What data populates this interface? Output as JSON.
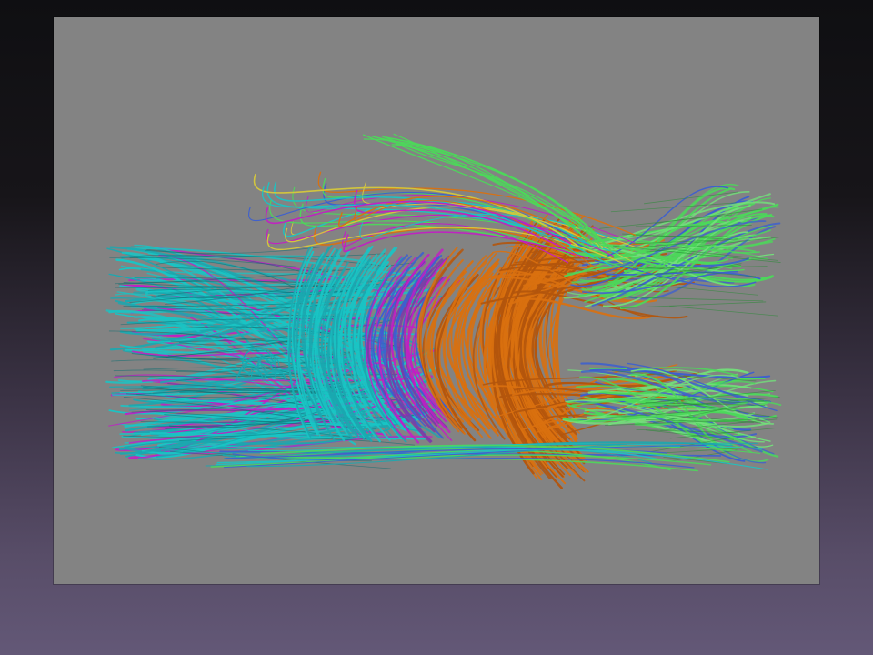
{
  "slide": {
    "background_top": "#0f0f12",
    "background_bottom": "#635877"
  },
  "figure": {
    "kind": "tractography-fiber-rendering",
    "panel_color": "#838383",
    "caption": "",
    "fiber_colors": {
      "cyan": "#19c4c4",
      "teal": "#1aa8b0",
      "magenta": "#c21ec4",
      "purple": "#7a3aa8",
      "orange": "#d9700f",
      "dark_orange": "#b3550c",
      "green": "#4cd85a",
      "light_green": "#72e07a",
      "blue": "#3c5fd0",
      "yellow": "#d6c83a"
    }
  }
}
